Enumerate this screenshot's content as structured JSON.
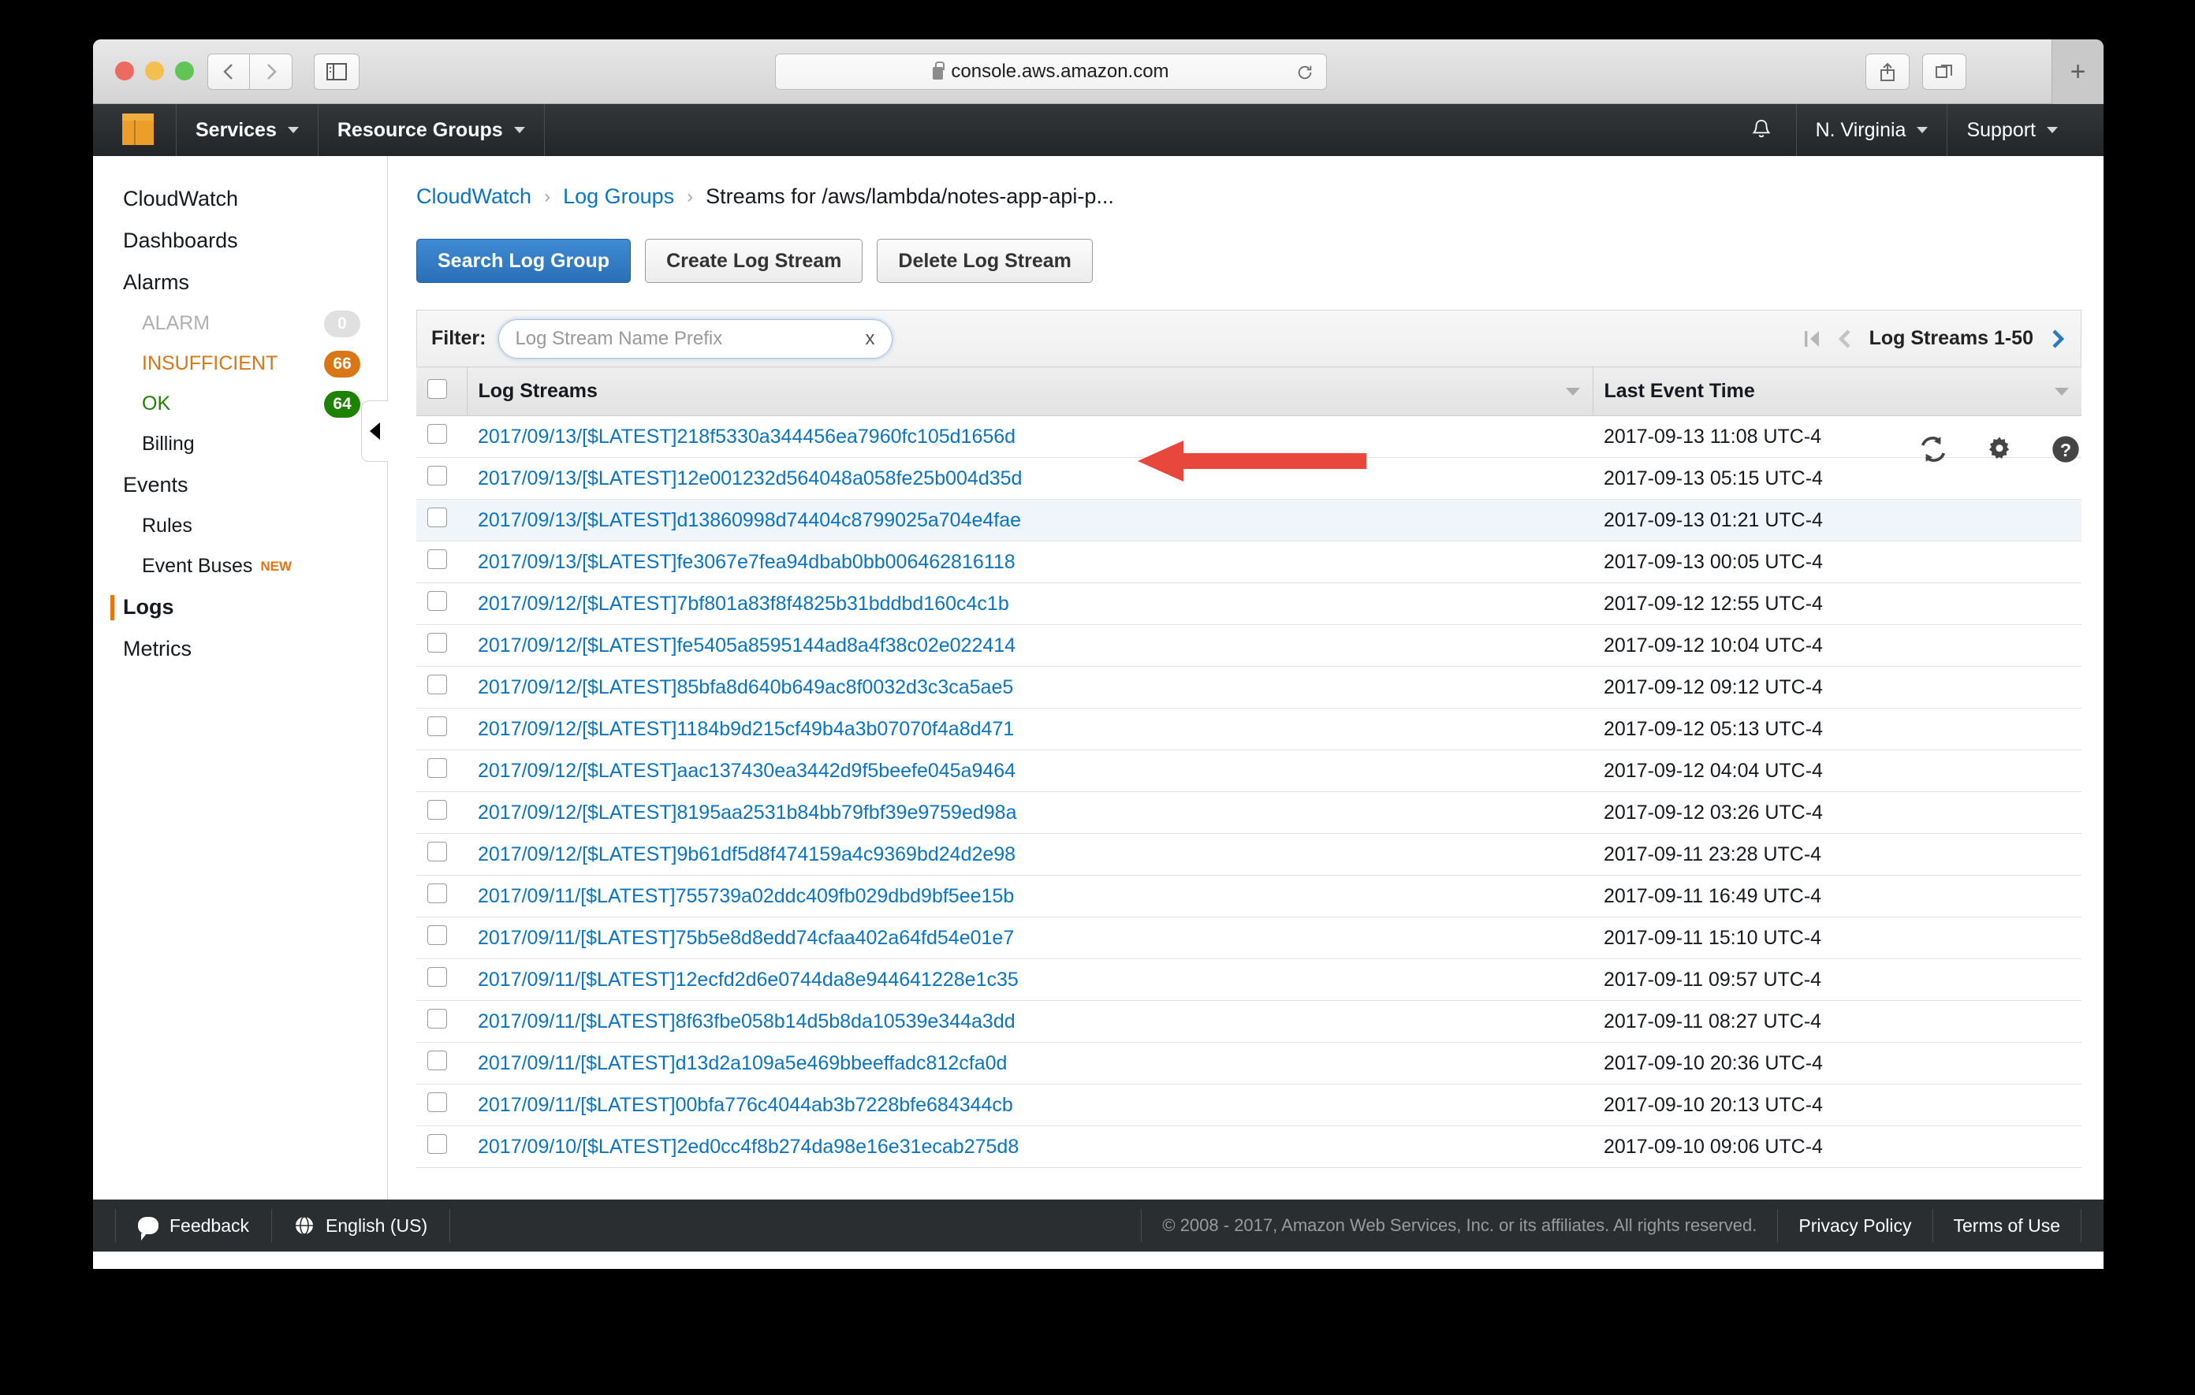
{
  "browser": {
    "url": "console.aws.amazon.com",
    "lock_icon": "lock-icon",
    "back_icon": "chevron-left-icon",
    "forward_icon": "chevron-right-icon",
    "sidebar_icon": "sidebar-toggle-icon",
    "reload_icon": "reload-icon",
    "share_icon": "share-icon",
    "tabs_icon": "show-all-tabs-icon",
    "newtab_label": "+"
  },
  "awsnav": {
    "logo_icon": "aws-cube-logo",
    "services_label": "Services",
    "resource_groups_label": "Resource Groups",
    "bell_icon": "bell-icon",
    "region_label": "N. Virginia",
    "support_label": "Support"
  },
  "sidebar": {
    "items": [
      {
        "label": "CloudWatch",
        "level": "top",
        "active": false
      },
      {
        "label": "Dashboards",
        "level": "top",
        "active": false
      },
      {
        "label": "Alarms",
        "level": "top",
        "active": false
      },
      {
        "label": "ALARM",
        "level": "sub",
        "active": false,
        "badge": "0",
        "badge_color": "#e0e0e0",
        "text_color": "#b0b0b0"
      },
      {
        "label": "INSUFFICIENT",
        "level": "sub",
        "active": false,
        "badge": "66",
        "badge_color": "#d97616",
        "text_color": "#d97616"
      },
      {
        "label": "OK",
        "level": "sub",
        "active": false,
        "badge": "64",
        "badge_color": "#1d8102",
        "text_color": "#1d8102"
      },
      {
        "label": "Billing",
        "level": "sub",
        "active": false
      },
      {
        "label": "Events",
        "level": "top",
        "active": false
      },
      {
        "label": "Rules",
        "level": "sub",
        "active": false
      },
      {
        "label": "Event Buses",
        "level": "sub",
        "active": false,
        "tag": "NEW"
      },
      {
        "label": "Logs",
        "level": "top",
        "active": true
      },
      {
        "label": "Metrics",
        "level": "top",
        "active": false
      }
    ],
    "collapse_icon": "collapse-sidebar-icon"
  },
  "breadcrumb": {
    "items": [
      "CloudWatch",
      "Log Groups",
      "Streams for /aws/lambda/notes-app-api-p..."
    ],
    "separator": "›"
  },
  "toolbar": {
    "search_label": "Search Log Group",
    "create_label": "Create Log Stream",
    "delete_label": "Delete Log Stream",
    "refresh_icon": "refresh-icon",
    "settings_icon": "gear-icon",
    "help_icon": "help-icon"
  },
  "filter": {
    "label": "Filter:",
    "placeholder": "Log Stream Name Prefix",
    "value": "",
    "clear_label": "x"
  },
  "pagination": {
    "first_icon": "first-page-icon",
    "prev_icon": "previous-page-icon",
    "label": "Log Streams 1-50",
    "next_icon": "next-page-icon"
  },
  "table": {
    "columns": [
      "Log Streams",
      "Last Event Time"
    ],
    "rows": [
      {
        "stream": "2017/09/13/[$LATEST]218f5330a344456ea7960fc105d1656d",
        "time": "2017-09-13 11:08 UTC-4",
        "highlight": false
      },
      {
        "stream": "2017/09/13/[$LATEST]12e001232d564048a058fe25b004d35d",
        "time": "2017-09-13 05:15 UTC-4",
        "highlight": false
      },
      {
        "stream": "2017/09/13/[$LATEST]d13860998d74404c8799025a704e4fae",
        "time": "2017-09-13 01:21 UTC-4",
        "highlight": true
      },
      {
        "stream": "2017/09/13/[$LATEST]fe3067e7fea94dbab0bb006462816118",
        "time": "2017-09-13 00:05 UTC-4",
        "highlight": false
      },
      {
        "stream": "2017/09/12/[$LATEST]7bf801a83f8f4825b31bddbd160c4c1b",
        "time": "2017-09-12 12:55 UTC-4",
        "highlight": false
      },
      {
        "stream": "2017/09/12/[$LATEST]fe5405a8595144ad8a4f38c02e022414",
        "time": "2017-09-12 10:04 UTC-4",
        "highlight": false
      },
      {
        "stream": "2017/09/12/[$LATEST]85bfa8d640b649ac8f0032d3c3ca5ae5",
        "time": "2017-09-12 09:12 UTC-4",
        "highlight": false
      },
      {
        "stream": "2017/09/12/[$LATEST]1184b9d215cf49b4a3b07070f4a8d471",
        "time": "2017-09-12 05:13 UTC-4",
        "highlight": false
      },
      {
        "stream": "2017/09/12/[$LATEST]aac137430ea3442d9f5beefe045a9464",
        "time": "2017-09-12 04:04 UTC-4",
        "highlight": false
      },
      {
        "stream": "2017/09/12/[$LATEST]8195aa2531b84bb79fbf39e9759ed98a",
        "time": "2017-09-12 03:26 UTC-4",
        "highlight": false
      },
      {
        "stream": "2017/09/12/[$LATEST]9b61df5d8f474159a4c9369bd24d2e98",
        "time": "2017-09-11 23:28 UTC-4",
        "highlight": false
      },
      {
        "stream": "2017/09/11/[$LATEST]755739a02ddc409fb029dbd9bf5ee15b",
        "time": "2017-09-11 16:49 UTC-4",
        "highlight": false
      },
      {
        "stream": "2017/09/11/[$LATEST]75b5e8d8edd74cfaa402a64fd54e01e7",
        "time": "2017-09-11 15:10 UTC-4",
        "highlight": false
      },
      {
        "stream": "2017/09/11/[$LATEST]12ecfd2d6e0744da8e944641228e1c35",
        "time": "2017-09-11 09:57 UTC-4",
        "highlight": false
      },
      {
        "stream": "2017/09/11/[$LATEST]8f63fbe058b14d5b8da10539e344a3dd",
        "time": "2017-09-11 08:27 UTC-4",
        "highlight": false
      },
      {
        "stream": "2017/09/11/[$LATEST]d13d2a109a5e469bbeeffadc812cfa0d",
        "time": "2017-09-10 20:36 UTC-4",
        "highlight": false
      },
      {
        "stream": "2017/09/11/[$LATEST]00bfa776c4044ab3b7228bfe684344cb",
        "time": "2017-09-10 20:13 UTC-4",
        "highlight": false
      },
      {
        "stream": "2017/09/10/[$LATEST]2ed0cc4f8b274da98e16e31ecab275d8",
        "time": "2017-09-10 09:06 UTC-4",
        "highlight": false
      }
    ]
  },
  "footer": {
    "feedback_label": "Feedback",
    "feedback_icon": "speech-bubble-icon",
    "language_label": "English (US)",
    "language_icon": "globe-icon",
    "copyright": "© 2008 - 2017, Amazon Web Services, Inc. or its affiliates. All rights reserved.",
    "privacy_label": "Privacy Policy",
    "terms_label": "Terms of Use"
  },
  "annotation": {
    "arrow_icon": "red-arrow-left-icon",
    "color": "#e8473b"
  }
}
